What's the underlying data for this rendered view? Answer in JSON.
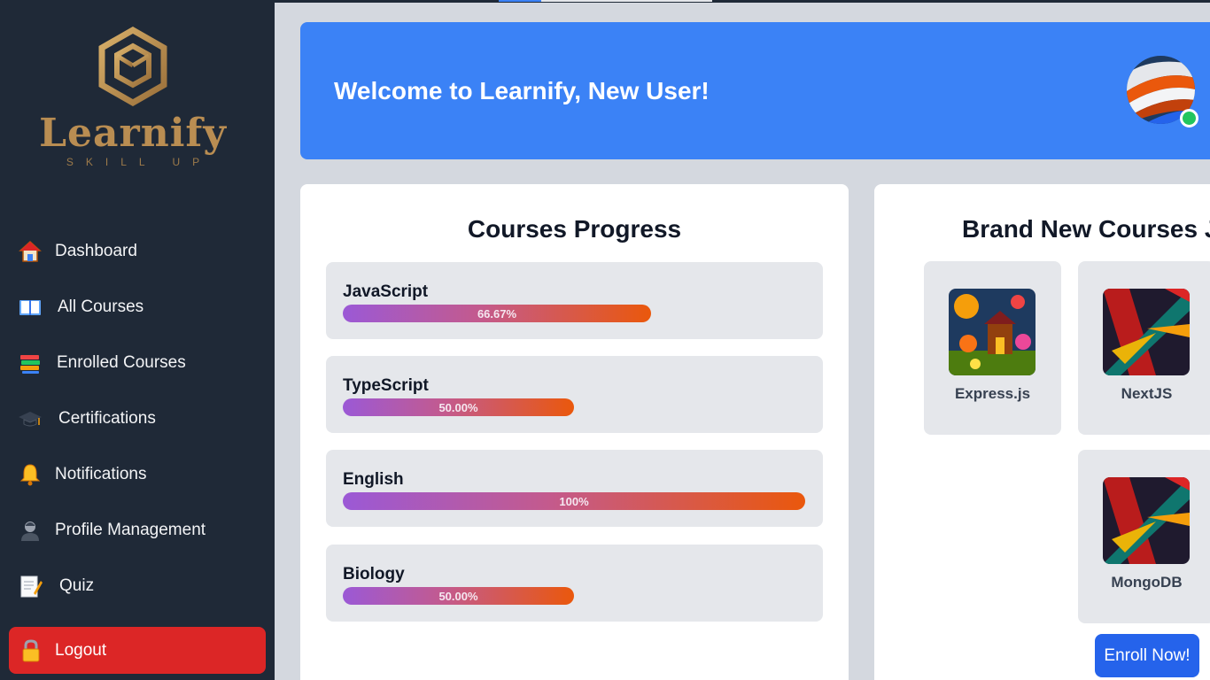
{
  "app": {
    "name": "Learnify",
    "tagline": "SKILL UP"
  },
  "sidebar": {
    "items": [
      {
        "label": "Dashboard",
        "icon": "house-icon"
      },
      {
        "label": "All Courses",
        "icon": "open-book-icon"
      },
      {
        "label": "Enrolled Courses",
        "icon": "book-stack-icon"
      },
      {
        "label": "Certifications",
        "icon": "graduation-cap-icon"
      },
      {
        "label": "Notifications",
        "icon": "bell-icon"
      },
      {
        "label": "Profile Management",
        "icon": "person-icon"
      },
      {
        "label": "Quiz",
        "icon": "memo-icon"
      }
    ],
    "logout_label": "Logout",
    "logout_icon": "lock-icon"
  },
  "header": {
    "welcome": "Welcome to Learnify, New User!",
    "status": "online"
  },
  "progress": {
    "title": "Courses Progress",
    "courses": [
      {
        "name": "JavaScript",
        "percent_label": "66.67%",
        "percent": 66.67
      },
      {
        "name": "TypeScript",
        "percent_label": "50.00%",
        "percent": 50
      },
      {
        "name": "English",
        "percent_label": "100%",
        "percent": 100
      },
      {
        "name": "Biology",
        "percent_label": "50.00%",
        "percent": 50
      }
    ]
  },
  "new_courses": {
    "title": "Brand New Courses Ju",
    "courses": [
      {
        "name": "Express.js"
      },
      {
        "name": "NextJS"
      },
      {
        "name": "MongoDB"
      }
    ],
    "enroll_label": "Enroll Now!"
  },
  "colors": {
    "sidebar_bg": "#1f2937",
    "banner_bg": "#3b82f6",
    "logout_bg": "#dc2626",
    "enroll_bg": "#2563eb",
    "logo_gold": "#b98d52"
  }
}
